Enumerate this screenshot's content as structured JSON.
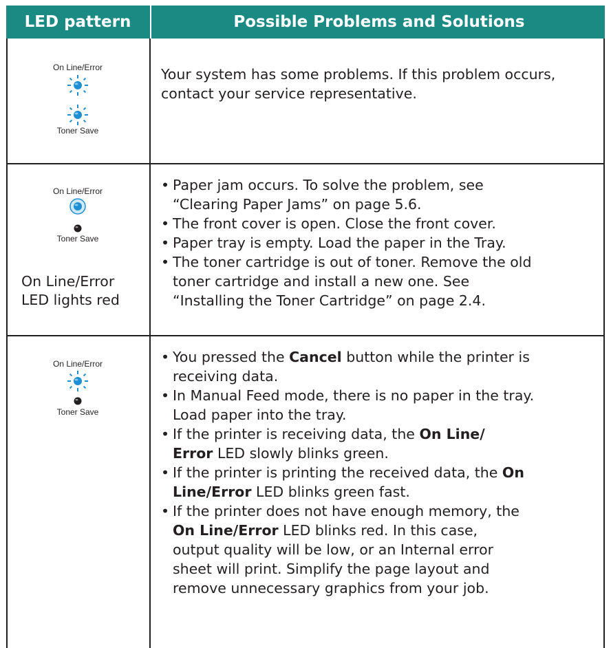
{
  "header": {
    "col1": "LED pattern",
    "col2": "Possible Problems and Solutions"
  },
  "led_labels": {
    "top": "On Line/Error",
    "bottom": "Toner Save"
  },
  "colors": {
    "header_bg": "#1a8a83",
    "led_blue": "#1f8fd4",
    "led_off": "#231f20"
  },
  "rows": [
    {
      "led_state": {
        "online_error": "blinking",
        "toner_save": "blinking"
      },
      "text": "Your system has some problems. If this problem occurs, contact your service representative."
    },
    {
      "led_state": {
        "online_error": "on",
        "toner_save": "off"
      },
      "note": [
        "On Line/Error",
        "LED lights red"
      ],
      "items": [
        [
          "Paper jam occurs. To solve the problem, see",
          "“Clearing Paper Jams” on page 5.6."
        ],
        [
          "The front cover is open. Close the front cover."
        ],
        [
          "Paper tray is empty. Load the paper in the Tray."
        ],
        [
          "The toner cartridge is out of toner. Remove the old",
          "toner cartridge and install a new one. See",
          "“Installing the Toner Cartridge” on page 2.4."
        ]
      ]
    },
    {
      "led_state": {
        "online_error": "blinking",
        "toner_save": "off"
      },
      "items_rich": [
        {
          "a": "You pressed the ",
          "b": "Cancel",
          "c": " button while the printer is",
          "d": "receiving data."
        },
        {
          "lines": [
            "In Manual Feed mode, there is no paper in the tray.",
            "Load paper into the tray."
          ]
        },
        {
          "a": "If the printer is receiving data, the ",
          "b": "On Line/",
          "b2": "Error",
          "c": " LED slowly blinks green."
        },
        {
          "a": "If the printer is printing the received data, the ",
          "b": "On",
          "b2": "Line/Error",
          "c": " LED blinks green fast."
        },
        {
          "a": "If the printer does not have enough memory, the",
          "b": "On Line/Error",
          "c": " LED blinks red. In this case,",
          "d": "output quality will be low, or an Internal error",
          "e": "sheet will print. Simplify the page layout and",
          "f": "remove unnecessary graphics from your job."
        }
      ]
    }
  ]
}
